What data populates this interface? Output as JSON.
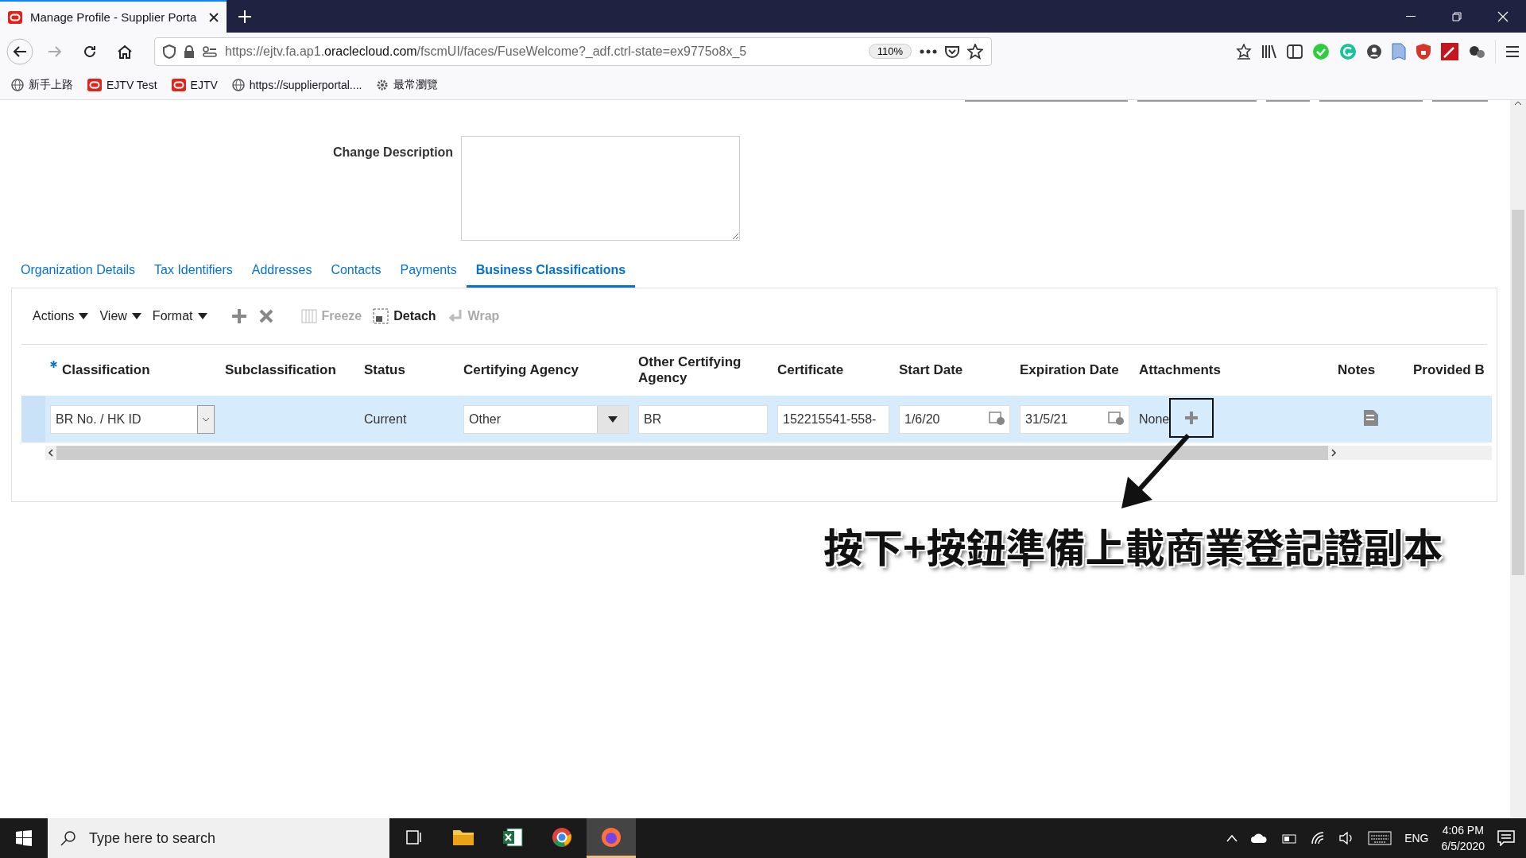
{
  "browser": {
    "tab_title": "Manage Profile - Supplier Porta",
    "url_start": "https://ejtv.fa.ap1.",
    "url_domain": "oraclecloud.com",
    "url_end": "/fscmUI/faces/FuseWelcome?_adf.ctrl-state=ex9775o8x_5",
    "zoom": "110%",
    "bookmarks": [
      {
        "label": "新手上路",
        "kind": "globe"
      },
      {
        "label": "EJTV Test",
        "kind": "oracle"
      },
      {
        "label": "EJTV",
        "kind": "oracle"
      },
      {
        "label": "https://supplierportal....",
        "kind": "globe"
      },
      {
        "label": "最常瀏覽",
        "kind": "gear"
      }
    ]
  },
  "form": {
    "change_description_label": "Change Description"
  },
  "tabs": [
    {
      "label": "Organization Details",
      "selected": false
    },
    {
      "label": "Tax Identifiers",
      "selected": false
    },
    {
      "label": "Addresses",
      "selected": false
    },
    {
      "label": "Contacts",
      "selected": false
    },
    {
      "label": "Payments",
      "selected": false
    },
    {
      "label": "Business Classifications",
      "selected": true
    }
  ],
  "toolbar": [
    {
      "kind": "menu",
      "label": "Actions",
      "disabled": false
    },
    {
      "kind": "menu",
      "label": "View",
      "disabled": false
    },
    {
      "kind": "menu",
      "label": "Format",
      "disabled": false
    },
    {
      "kind": "add",
      "disabled": false
    },
    {
      "kind": "delete",
      "disabled": false
    },
    {
      "kind": "freeze",
      "label": "Freeze",
      "disabled": true
    },
    {
      "kind": "detach",
      "label": "Detach",
      "disabled": false
    },
    {
      "kind": "wrap",
      "label": "Wrap",
      "disabled": true
    }
  ],
  "table": {
    "columns": [
      {
        "label": "Classification",
        "required": true
      },
      {
        "label": "Subclassification",
        "required": false
      },
      {
        "label": "Status",
        "required": false
      },
      {
        "label": "Certifying Agency",
        "required": false
      },
      {
        "label": "Other Certifying Agency",
        "required": false
      },
      {
        "label": "Certificate",
        "required": false
      },
      {
        "label": "Start Date",
        "required": false
      },
      {
        "label": "Expiration Date",
        "required": false
      },
      {
        "label": "Attachments",
        "required": false
      },
      {
        "label": "Notes",
        "required": false
      },
      {
        "label": "Provided B",
        "required": false
      }
    ],
    "rows": [
      {
        "selected": true,
        "cells": [
          {
            "kind": "choice",
            "value": "BR No. / HK ID"
          },
          {
            "kind": "blank"
          },
          {
            "kind": "text",
            "value": "Current"
          },
          {
            "kind": "dropdown",
            "value": "Other"
          },
          {
            "kind": "input",
            "value": "BR"
          },
          {
            "kind": "input",
            "value": "152215541-558-"
          },
          {
            "kind": "date",
            "value": "1/6/20"
          },
          {
            "kind": "date",
            "value": "31/5/21"
          },
          {
            "kind": "attachment",
            "value": "None"
          },
          {
            "kind": "notes"
          },
          {
            "kind": "blank"
          }
        ]
      }
    ]
  },
  "annotation": {
    "text": "按下+按鈕準備上載商業登記證副本"
  },
  "taskbar": {
    "search_placeholder": "Type here to search",
    "apps": [
      {
        "kind": "taskview",
        "active": false
      },
      {
        "kind": "files",
        "active": false
      },
      {
        "kind": "excel",
        "active": false
      },
      {
        "kind": "chrome",
        "active": false
      },
      {
        "kind": "firefox",
        "active": true
      }
    ],
    "language": "ENG",
    "time": "4:06 PM",
    "date": "6/5/2020"
  }
}
